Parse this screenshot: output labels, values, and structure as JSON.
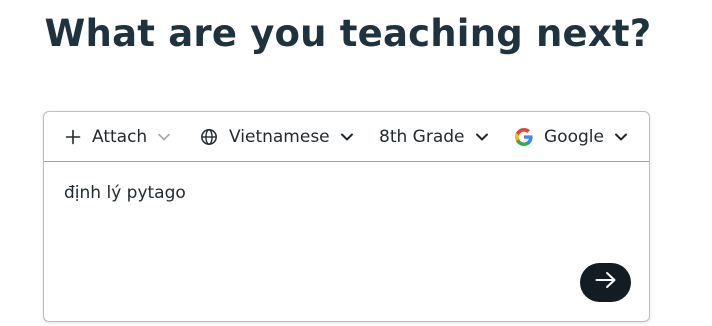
{
  "heading": "What are you teaching next?",
  "toolbar": {
    "attach": {
      "label": "Attach",
      "icon": "plus-icon",
      "caret": "chevron-down-icon"
    },
    "language": {
      "label": "Vietnamese",
      "icon": "globe-icon",
      "caret": "chevron-down-icon"
    },
    "grade": {
      "label": "8th Grade",
      "caret": "chevron-down-icon"
    },
    "model": {
      "label": "Google",
      "icon": "google-icon",
      "caret": "chevron-down-icon"
    }
  },
  "prompt": {
    "value": "định lý pytago"
  },
  "send": {
    "icon": "arrow-right-icon"
  },
  "colors": {
    "heading": "#1f333e",
    "send_button": "#121c22",
    "border": "#b9bfc4",
    "attach_caret": "#a4abb0"
  }
}
